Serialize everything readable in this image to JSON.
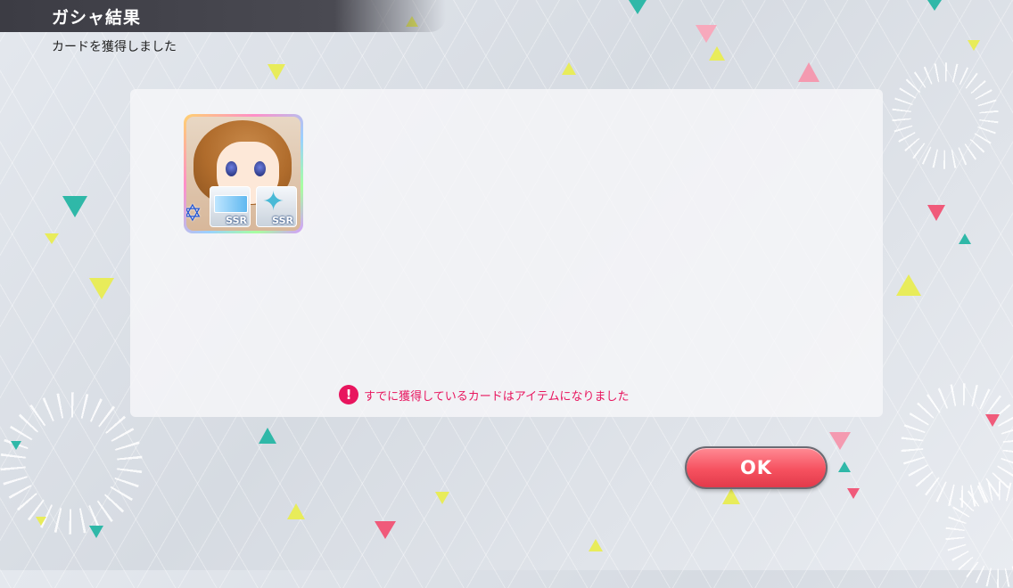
{
  "header": {
    "title": "ガシャ結果",
    "subtitle": "カードを獲得しました"
  },
  "result_card": {
    "badges": [
      {
        "icon": "ticket-icon",
        "label": "SSR"
      },
      {
        "icon": "star-icon",
        "label": "SSR"
      }
    ],
    "rank_icon": "rank-star-icon"
  },
  "notice": {
    "icon": "exclamation-icon",
    "text": "すでに獲得しているカードはアイテムになりました"
  },
  "ok_button": {
    "label": "OK"
  },
  "colors": {
    "accent_pink": "#e8155e",
    "ok_button": "#f6515f",
    "header_bar": "#3c3c44"
  }
}
